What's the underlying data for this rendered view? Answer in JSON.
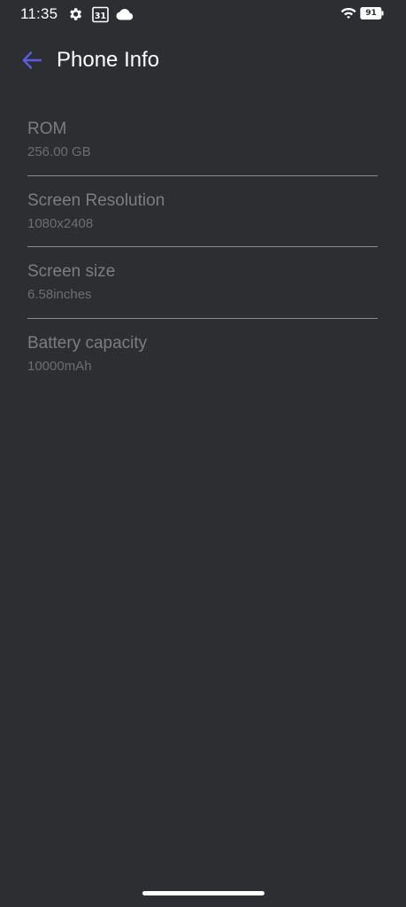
{
  "status_bar": {
    "time": "11:35",
    "icons": [
      "gear-icon",
      "calendar-icon",
      "cloud-icon",
      "wifi-icon",
      "battery-icon"
    ],
    "calendar_day": "31",
    "battery_level": "91"
  },
  "header": {
    "title": "Phone Info",
    "back_icon": "arrow-left-icon",
    "accent_color": "#5b5ce0"
  },
  "info_items": [
    {
      "title": "ROM",
      "value": "256.00 GB"
    },
    {
      "title": "Screen Resolution",
      "value": "1080x2408"
    },
    {
      "title": "Screen size",
      "value": "6.58inches"
    },
    {
      "title": "Battery capacity",
      "value": "10000mAh"
    }
  ],
  "colors": {
    "background": "#2d2e32",
    "title_text": "#ffffff",
    "item_title": "#7c7d82",
    "item_value": "#6c6d72"
  }
}
